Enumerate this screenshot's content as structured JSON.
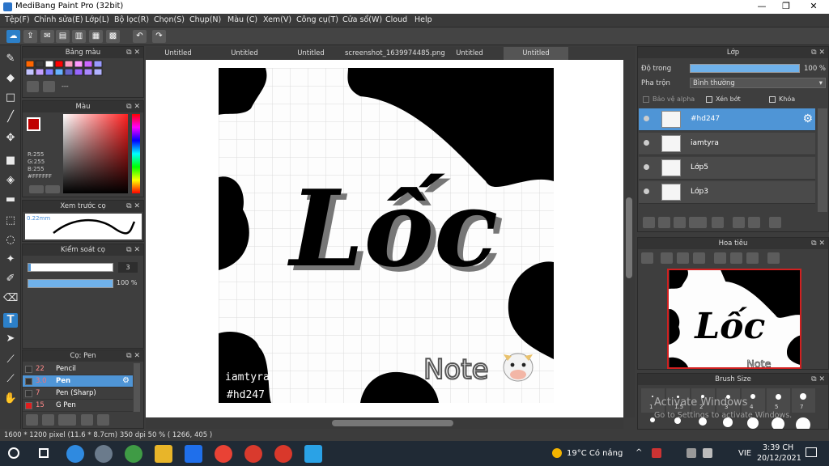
{
  "window": {
    "title": "MediBang Paint Pro (32bit)"
  },
  "menu": [
    "Tệp(F)",
    "Chỉnh sửa(E)",
    "Lớp(L)",
    "Bộ lọc(R)",
    "Chọn(S)",
    "Chụp(N)",
    "Màu (C)",
    "Xem(V)",
    "Công cụ(T)",
    "Cửa sổ(W)",
    "Cloud",
    "Help"
  ],
  "panels": {
    "palette": {
      "title": "Bảng màu",
      "value": "---"
    },
    "color": {
      "title": "Màu",
      "r": "R:255",
      "g": "G:255",
      "b": "B:255",
      "hex": "#FFFFFF"
    },
    "brush_preview": {
      "title": "Xem trước cọ",
      "size": "0.22mm"
    },
    "brush_control": {
      "title": "Kiểm soát cọ",
      "size_value": "3",
      "opacity_value": "100 %"
    },
    "brushes": {
      "title": "Cọ: Pen",
      "items": [
        {
          "num": "22",
          "name": "Pencil",
          "sel": false
        },
        {
          "num": "3.0",
          "name": "Pen",
          "sel": true
        },
        {
          "num": "7",
          "name": "Pen (Sharp)",
          "sel": false
        },
        {
          "num": "15",
          "name": "G Pen",
          "sel": false
        }
      ]
    }
  },
  "tabs": [
    "Untitled",
    "Untitled",
    "Untitled",
    "screenshot_1639974485.png",
    "Untitled",
    "Untitled"
  ],
  "active_tab": 5,
  "canvas": {
    "title_text": "Lốc",
    "handle": "iamtyra",
    "tag": "#hd247",
    "note": "Note"
  },
  "layers": {
    "title": "Lớp",
    "opacity_label": "Độ trong",
    "opacity_value": "100 %",
    "blend_label": "Pha trộn",
    "blend_value": "Bình thường",
    "protect_alpha": "Bảo vệ alpha",
    "clip": "Xén bớt",
    "lock": "Khóa",
    "items": [
      "#hd247",
      "iamtyra",
      "Lớp5",
      "Lớp3"
    ]
  },
  "navigator": {
    "title": "Hoa tiêu"
  },
  "brush_size": {
    "title": "Brush Size",
    "labels": [
      "1",
      "1.5",
      "2",
      "3",
      "4",
      "5",
      "7"
    ]
  },
  "activation": {
    "line1": "Activate Windows",
    "line2": "Go to Settings to activate Windows."
  },
  "status": {
    "text": "1600 * 1200 pixel   (11.6 * 8.7cm)   350 dpi   50 %   ( 1266, 405 )"
  },
  "taskbar": {
    "weather": "19°C  Có nắng",
    "lang": "VIE",
    "time": "3:39 CH",
    "date": "20/12/2021"
  },
  "colors": {
    "accent": "#4f95d6",
    "primary": "#c00000"
  }
}
